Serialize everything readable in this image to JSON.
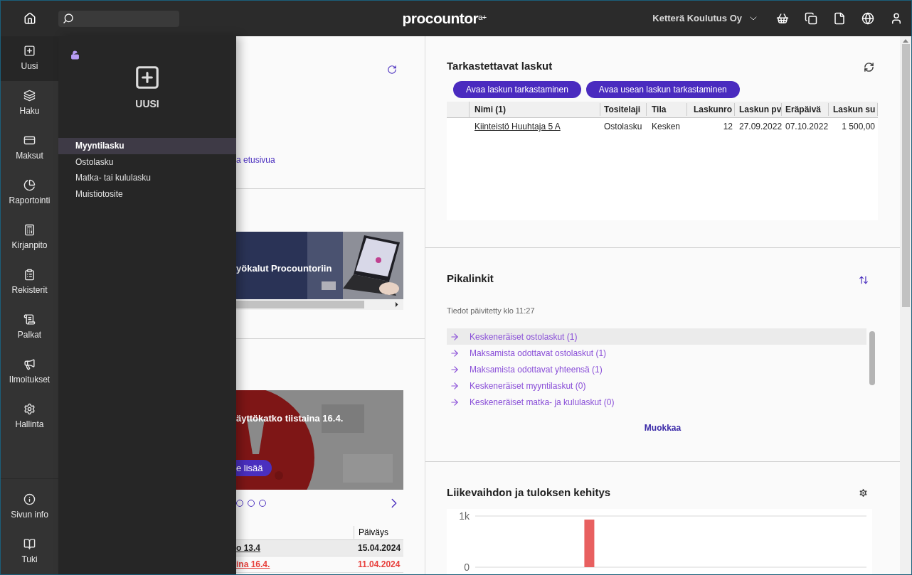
{
  "topbar": {
    "logo": "procountor",
    "logo_sup": "a+",
    "company": "Ketterä Koulutus Oy"
  },
  "nav_rail": {
    "items": [
      {
        "label": "Uusi",
        "selected": true
      },
      {
        "label": "Haku",
        "selected": false
      },
      {
        "label": "Maksut",
        "selected": false
      },
      {
        "label": "Raportointi",
        "selected": false
      },
      {
        "label": "Kirjanpito",
        "selected": false
      },
      {
        "label": "Rekisterit",
        "selected": false
      },
      {
        "label": "Palkat",
        "selected": false
      },
      {
        "label": "Ilmoitukset",
        "selected": false
      },
      {
        "label": "Hallinta",
        "selected": false
      }
    ],
    "bottom_items": [
      {
        "label": "Sivun info",
        "selected": false
      },
      {
        "label": "Tuki",
        "selected": false
      }
    ]
  },
  "flyout": {
    "title": "UUSI",
    "items": [
      {
        "label": "Myyntilasku",
        "selected": true
      },
      {
        "label": "Ostolasku",
        "selected": false
      },
      {
        "label": "Matka- tai kululasku",
        "selected": false
      },
      {
        "label": "Muistiotosite",
        "selected": false
      }
    ]
  },
  "middle": {
    "link": "a etusivua",
    "banner_1": {
      "caption": "yökalut Procountoriin"
    },
    "banner_2": {
      "caption": "äyttökatko tiistaina 16.4.",
      "button": "e lisää"
    },
    "dots": [
      {
        "selected": false
      },
      {
        "selected": false
      },
      {
        "selected": false
      }
    ],
    "table": {
      "columns": [
        "Päiväys"
      ],
      "rows": [
        {
          "title": "o 13.4",
          "date": "15.04.2024",
          "kind": "info"
        },
        {
          "title": "ina 16.4.",
          "date": "11.04.2024",
          "kind": "alert"
        }
      ]
    }
  },
  "review": {
    "title": "Tarkastettavat laskut",
    "buttons": [
      "Avaa laskun tarkastaminen",
      "Avaa usean laskun tarkastaminen"
    ],
    "columns": [
      "Nimi (1)",
      "Tositelaji",
      "Tila",
      "Laskunro",
      "Laskun pv",
      "Eräpäivä",
      "Laskun su"
    ],
    "rows": [
      [
        "Kiinteistö Huuhtaja 5 A",
        "Ostolasku",
        "Kesken",
        "12",
        "27.09.2022",
        "07.10.2022",
        "1 500,00"
      ]
    ]
  },
  "quicklinks": {
    "title": "Pikalinkit",
    "updated": "Tiedot päivitetty klo 11:27",
    "links": [
      {
        "label": "Keskeneräiset ostolaskut (1)",
        "selected": true
      },
      {
        "label": "Maksamista odottavat ostolaskut (1)",
        "selected": false
      },
      {
        "label": "Maksamista odottavat yhteensä (1)",
        "selected": false
      },
      {
        "label": "Keskeneräiset myyntilaskut (0)",
        "selected": false
      },
      {
        "label": "Keskeneräiset matka- ja kululaskut (0)",
        "selected": false
      }
    ],
    "edit": "Muokkaa"
  },
  "revenue": {
    "title": "Liikevaihdon ja tuloksen kehitys",
    "chart_data": {
      "type": "bar",
      "series": [
        {
          "color": "#e86060",
          "values": [
            null,
            null,
            null,
            930,
            null,
            null,
            null,
            null,
            null,
            null,
            null,
            null
          ]
        }
      ],
      "ylim": [
        0,
        1000
      ],
      "yticks": [
        0,
        {
          "value": 1000,
          "label": "1k"
        }
      ]
    }
  }
}
